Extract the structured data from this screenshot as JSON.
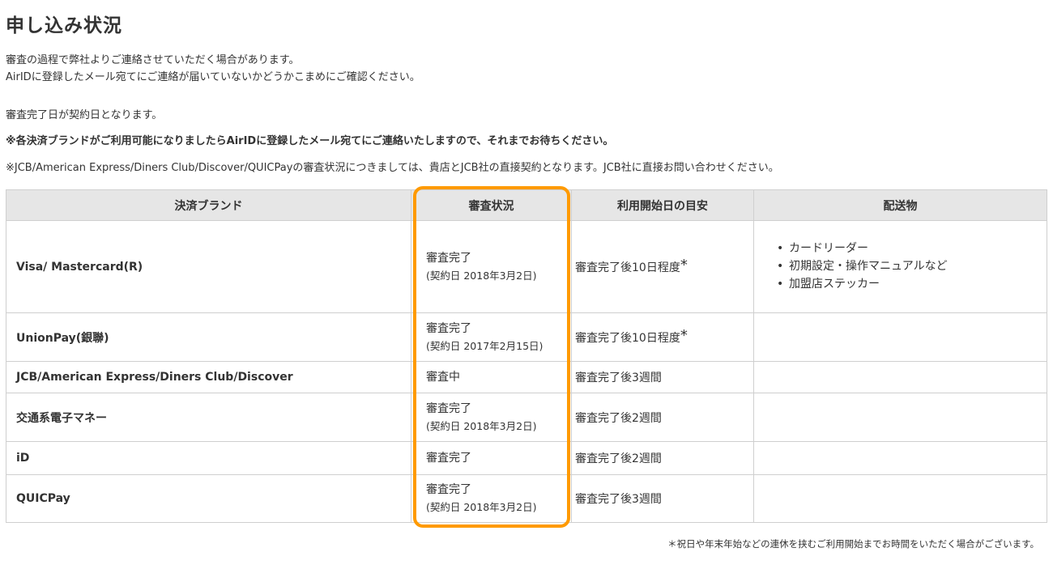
{
  "title": "申し込み状況",
  "intro": {
    "line1": "審査の過程で弊社よりご連絡させていただく場合があります。",
    "line2": "AirIDに登録したメール宛てにご連絡が届いていないかどうかこまめにご確認ください。",
    "line3": "審査完了日が契約日となります。",
    "line4": "※各決済ブランドがご利用可能になりましたらAirIDに登録したメール宛てにご連絡いたしますので、それまでお待ちください。",
    "line5": "※JCB/American Express/Diners Club/Discover/QUICPayの審査状況につきましては、貴店とJCB社の直接契約となります。JCB社に直接お問い合わせください。"
  },
  "table": {
    "headers": {
      "brand": "決済ブランド",
      "status": "審査状況",
      "start": "利用開始日の目安",
      "ship": "配送物"
    },
    "rows": [
      {
        "brand": "Visa/ Mastercard(R)",
        "status": "審査完了",
        "contract": "(契約日 2018年3月2日)",
        "start": "審査完了後10日程度",
        "mark": "*",
        "ship": [
          "カードリーダー",
          "初期設定・操作マニュアルなど",
          "加盟店ステッカー"
        ]
      },
      {
        "brand": "UnionPay(銀聯)",
        "status": "審査完了",
        "contract": "(契約日 2017年2月15日)",
        "start": "審査完了後10日程度",
        "mark": "*"
      },
      {
        "brand": "JCB/American Express/Diners Club/Discover",
        "status": "審査中",
        "start": "審査完了後3週間"
      },
      {
        "brand": "交通系電子マネー",
        "status": "審査完了",
        "contract": "(契約日 2018年3月2日)",
        "start": "審査完了後2週間"
      },
      {
        "brand": "iD",
        "status": "審査完了",
        "start": "審査完了後2週間"
      },
      {
        "brand": "QUICPay",
        "status": "審査完了",
        "contract": "(契約日 2018年3月2日)",
        "start": "審査完了後3週間"
      }
    ]
  },
  "footnote": "＊祝日や年末年始などの連休を挟むご利用開始までお時間をいただく場合がございます。",
  "colors": {
    "highlight": "#ff9a00",
    "header_bg": "#e6e6e6",
    "border": "#cfcfcf",
    "text": "#333333"
  }
}
